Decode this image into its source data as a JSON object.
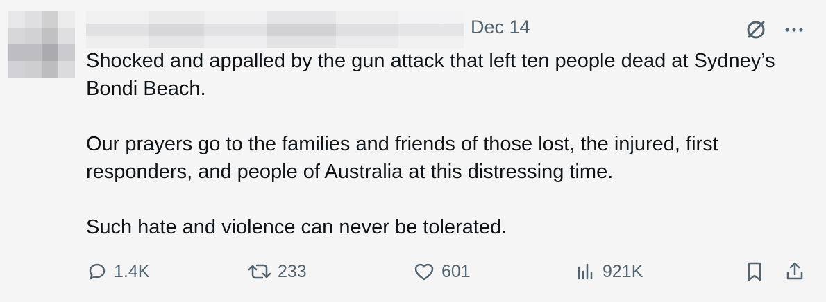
{
  "post": {
    "date": "Dec 14",
    "paragraphs": [
      "Shocked and appalled by the gun attack that left ten people dead at Sydney’s Bondi Beach.",
      "Our prayers go to the families and friends of those lost, the injured, first responders, and people of Australia at this distressing time.",
      "Such hate and violence can never be tolerated."
    ]
  },
  "metrics": {
    "replies": "1.4K",
    "reposts": "233",
    "likes": "601",
    "views": "921K"
  },
  "icons": {
    "grok": "grok-icon",
    "more": "more-icon",
    "reply": "reply-icon",
    "repost": "repost-icon",
    "like": "heart-icon",
    "views": "views-icon",
    "bookmark": "bookmark-icon",
    "share": "share-icon"
  },
  "colors": {
    "background": "#f5f5f5",
    "text": "#0f1419",
    "muted": "#536471"
  }
}
